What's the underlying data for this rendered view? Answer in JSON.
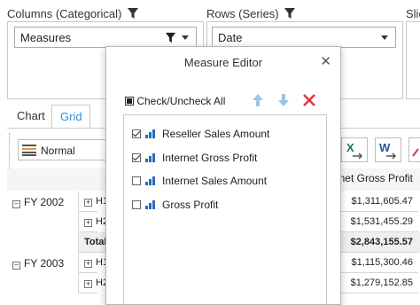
{
  "pivot": {
    "columns_header": "Columns (Categorical)",
    "rows_header": "Rows (Series)",
    "slices_header": "Slic",
    "columns_field": "Measures",
    "rows_field": "Date"
  },
  "tabs": [
    {
      "label": "Chart"
    },
    {
      "label": "Grid"
    }
  ],
  "toolbar": {
    "view_mode": "Normal"
  },
  "grid": {
    "column_header": "Internet Gross Profit",
    "rows": [
      {
        "year": "FY 2002",
        "sub": "H1",
        "value": "$1,311,605.47"
      },
      {
        "year": "",
        "sub": "H2",
        "value": "$1,531,455.29"
      },
      {
        "year": "",
        "sub": "Total",
        "value": "$2,843,155.57"
      },
      {
        "year": "FY 2003",
        "sub": "H1",
        "value": "$1,115,300.46"
      },
      {
        "year": "",
        "sub": "H2",
        "value": "$1,279,152.85"
      }
    ]
  },
  "measure_editor": {
    "title": "Measure Editor",
    "check_all_label": "Check/Uncheck All",
    "measures": [
      {
        "label": "Reseller Sales Amount",
        "checked": true
      },
      {
        "label": "Internet Gross Profit",
        "checked": true
      },
      {
        "label": "Internet Sales Amount",
        "checked": false
      },
      {
        "label": "Gross Profit",
        "checked": false
      }
    ]
  },
  "colors": {
    "accent": "#2b8fd6",
    "delete": "#e0393e",
    "excel": "#1e7a3e",
    "word": "#2b5797"
  }
}
